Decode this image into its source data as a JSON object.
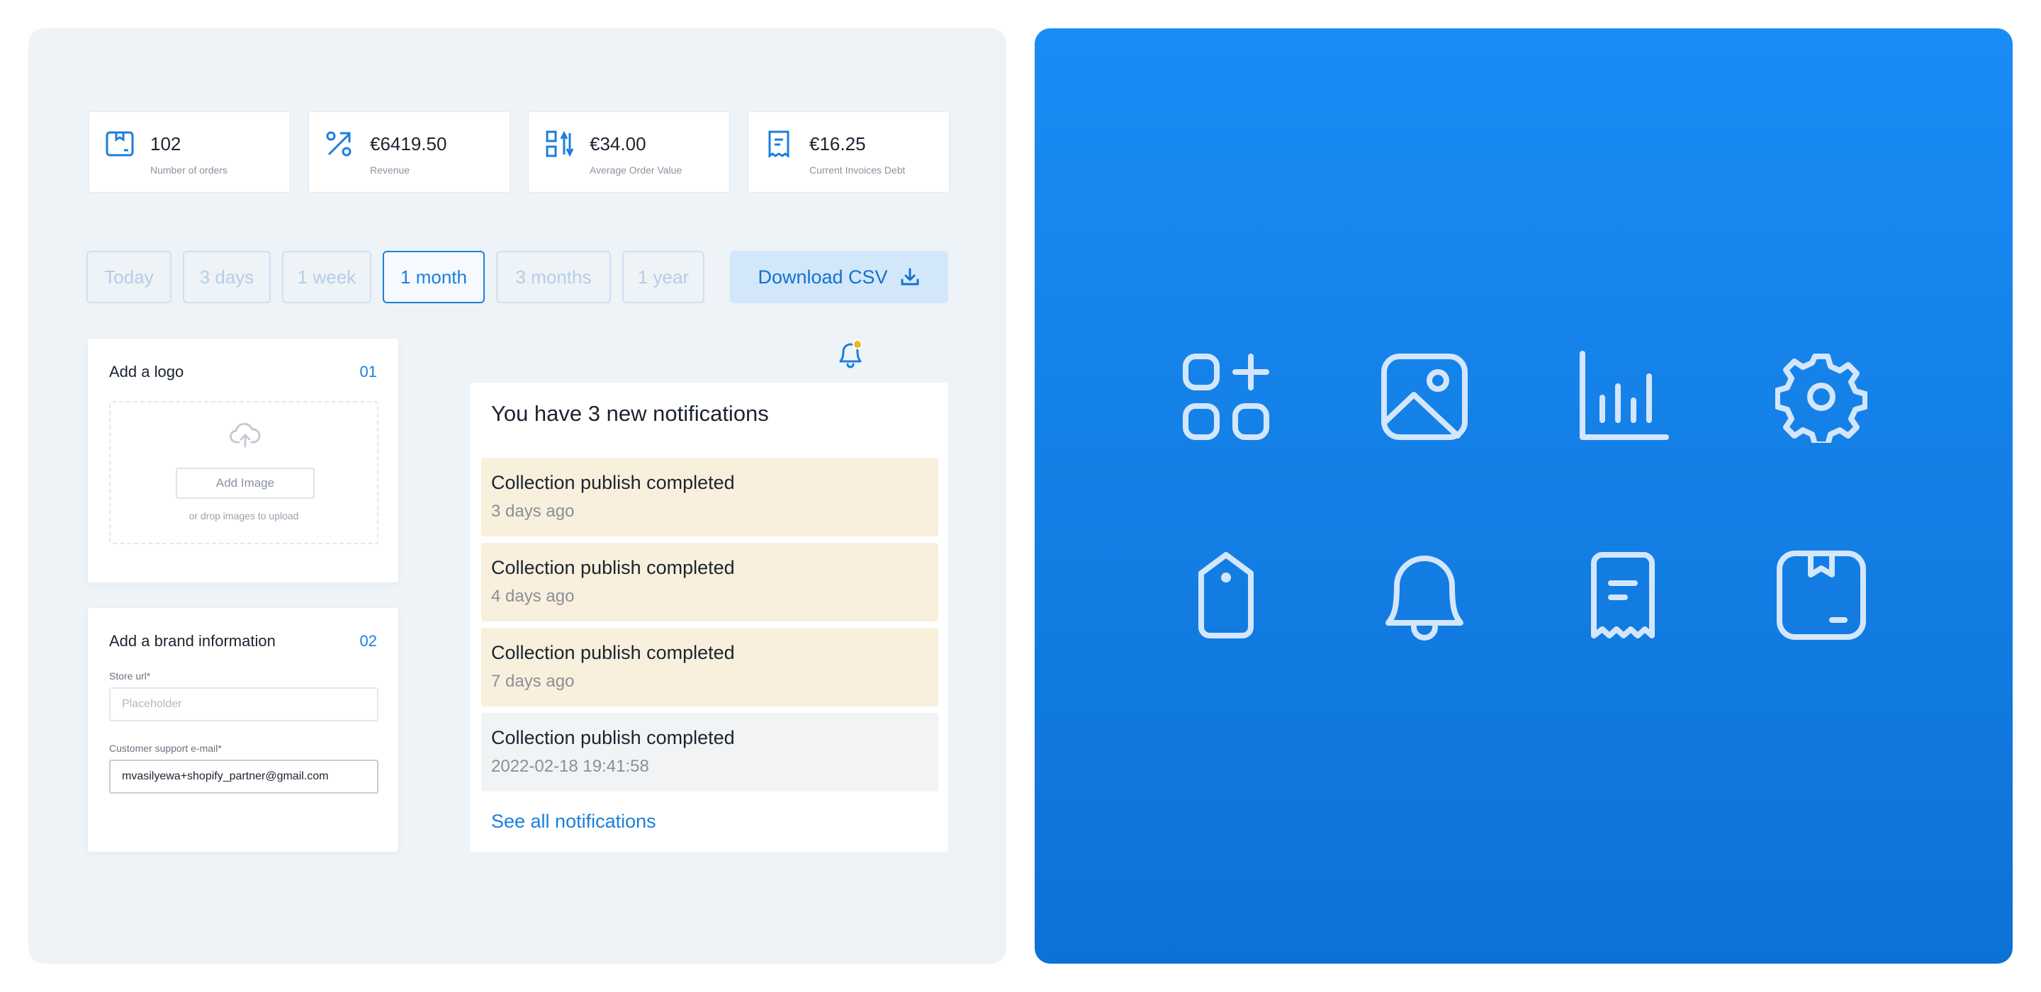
{
  "stats": [
    {
      "icon": "box-icon",
      "value": "102",
      "label": "Number of orders"
    },
    {
      "icon": "percent-icon",
      "value": "€6419.50",
      "label": "Revenue"
    },
    {
      "icon": "sort-arrows-icon",
      "value": "€34.00",
      "label": "Average Order Value"
    },
    {
      "icon": "receipt-icon",
      "value": "€16.25",
      "label": "Current Invoices Debt"
    }
  ],
  "periods": [
    {
      "label": "Today",
      "active": false
    },
    {
      "label": "3 days",
      "active": false
    },
    {
      "label": "1 week",
      "active": false
    },
    {
      "label": "1 month",
      "active": true
    },
    {
      "label": "3 months",
      "active": false
    },
    {
      "label": "1 year",
      "active": false
    }
  ],
  "download": {
    "label": "Download CSV"
  },
  "logo_card": {
    "title": "Add a logo",
    "step": "01",
    "add_image": "Add Image",
    "hint": "or drop images to upload"
  },
  "brand_card": {
    "title": "Add a brand information",
    "step": "02",
    "store_url_label": "Store url*",
    "store_url_placeholder": "Placeholder",
    "email_label": "Customer support e-mail*",
    "email_value": "mvasilyewa+shopify_partner@gmail.com"
  },
  "notifications": {
    "header": "You have 3 new notifications",
    "items": [
      {
        "title": "Collection publish completed",
        "time": "3 days ago",
        "unread": true
      },
      {
        "title": "Collection publish completed",
        "time": "4 days ago",
        "unread": true
      },
      {
        "title": "Collection publish completed",
        "time": "7 days ago",
        "unread": true
      },
      {
        "title": "Collection publish completed",
        "time": "2022-02-18 19:41:58",
        "unread": false
      }
    ],
    "see_all": "See all notifications"
  },
  "icon_grid": [
    "apps-add-icon",
    "image-icon",
    "bar-chart-icon",
    "gear-icon",
    "tag-icon",
    "bell-icon",
    "receipt-icon",
    "box-icon"
  ],
  "colors": {
    "accent": "#1a7fdc",
    "unread_bg": "#f8f0dd",
    "right_panel": "#1a8cf5",
    "badge": "#f0b429"
  }
}
